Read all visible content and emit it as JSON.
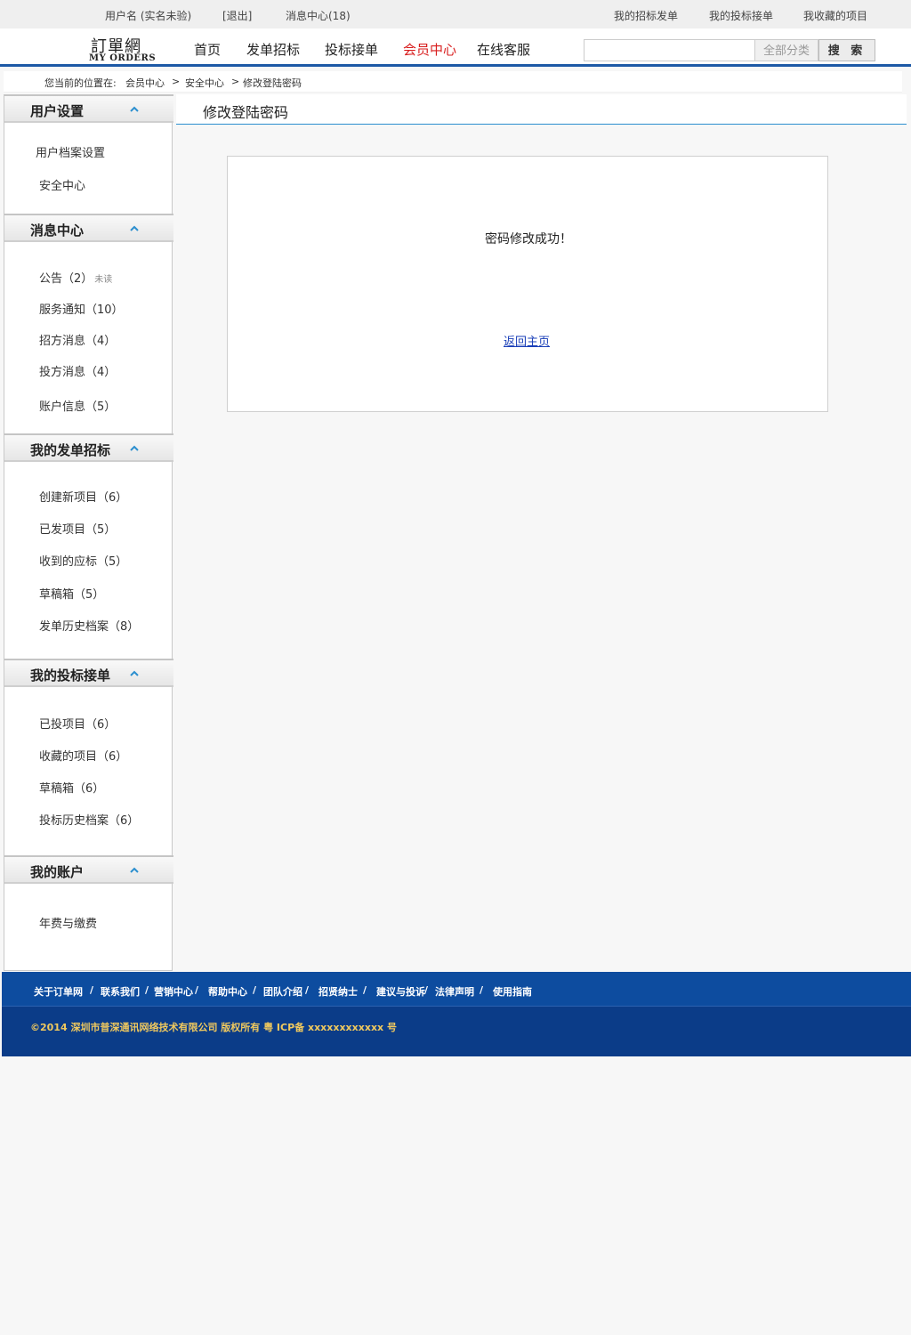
{
  "topbar": {
    "user": "用户名 (实名未验)",
    "logout": "[退出]",
    "messages": "消息中心(18)",
    "links": [
      "我的招标发单",
      "我的投标接单",
      "我收藏的项目"
    ]
  },
  "logo": {
    "cn": "訂單網",
    "en": "MY ORDERS"
  },
  "nav": {
    "items": [
      "首页",
      "发单招标",
      "投标接单",
      "会员中心",
      "在线客服"
    ],
    "active": "会员中心"
  },
  "search": {
    "value": "",
    "category": "全部分类",
    "button": "搜 索"
  },
  "breadcrumb": {
    "prefix": "您当前的位置在:",
    "items": [
      "会员中心",
      "安全中心",
      "修改登陆密码"
    ],
    "separator": ">"
  },
  "sidebar": {
    "sections": [
      {
        "title": "用户设置",
        "items": [
          "用户档案设置",
          "安全中心"
        ]
      },
      {
        "title": "消息中心",
        "items": [
          "公告（2）",
          "服务通知（10）",
          "招方消息（4）",
          "投方消息（4）",
          "账户信息（5）"
        ],
        "announcement_badge": "未读"
      },
      {
        "title": "我的发单招标",
        "items": [
          "创建新项目（6）",
          "已发项目（5）",
          "收到的应标（5）",
          "草稿箱（5）",
          "发单历史档案（8）"
        ]
      },
      {
        "title": "我的投标接单",
        "items": [
          "已投项目（6）",
          "收藏的项目（6）",
          "草稿箱（6）",
          "投标历史档案（6）"
        ]
      },
      {
        "title": "我的账户",
        "items": [
          "年费与缴费"
        ]
      }
    ]
  },
  "main": {
    "title": "修改登陆密码",
    "message": "密码修改成功！",
    "back_link": "返回主页"
  },
  "footer": {
    "links": [
      "关于订单网",
      "联系我们",
      "营销中心",
      "帮助中心",
      "团队介绍",
      "招贤纳士",
      "建议与投诉",
      "法律声明",
      "使用指南"
    ],
    "separator": "/",
    "copyright": "©2014 深圳市普深通讯网络技术有限公司 版权所有 粤 ICP备 xxxxxxxxxxxx 号"
  },
  "colors": {
    "header_rule": "#1d59a6",
    "nav_active": "#d81e1e",
    "footer_links_bg": "#0d4c9f",
    "footer_bg": "#0b3c88",
    "copyright": "#f0c95e",
    "link": "#1a3fb8",
    "chevron": "#2c8fcf"
  },
  "icons": {
    "section_toggle": "chevron-up-icon"
  }
}
